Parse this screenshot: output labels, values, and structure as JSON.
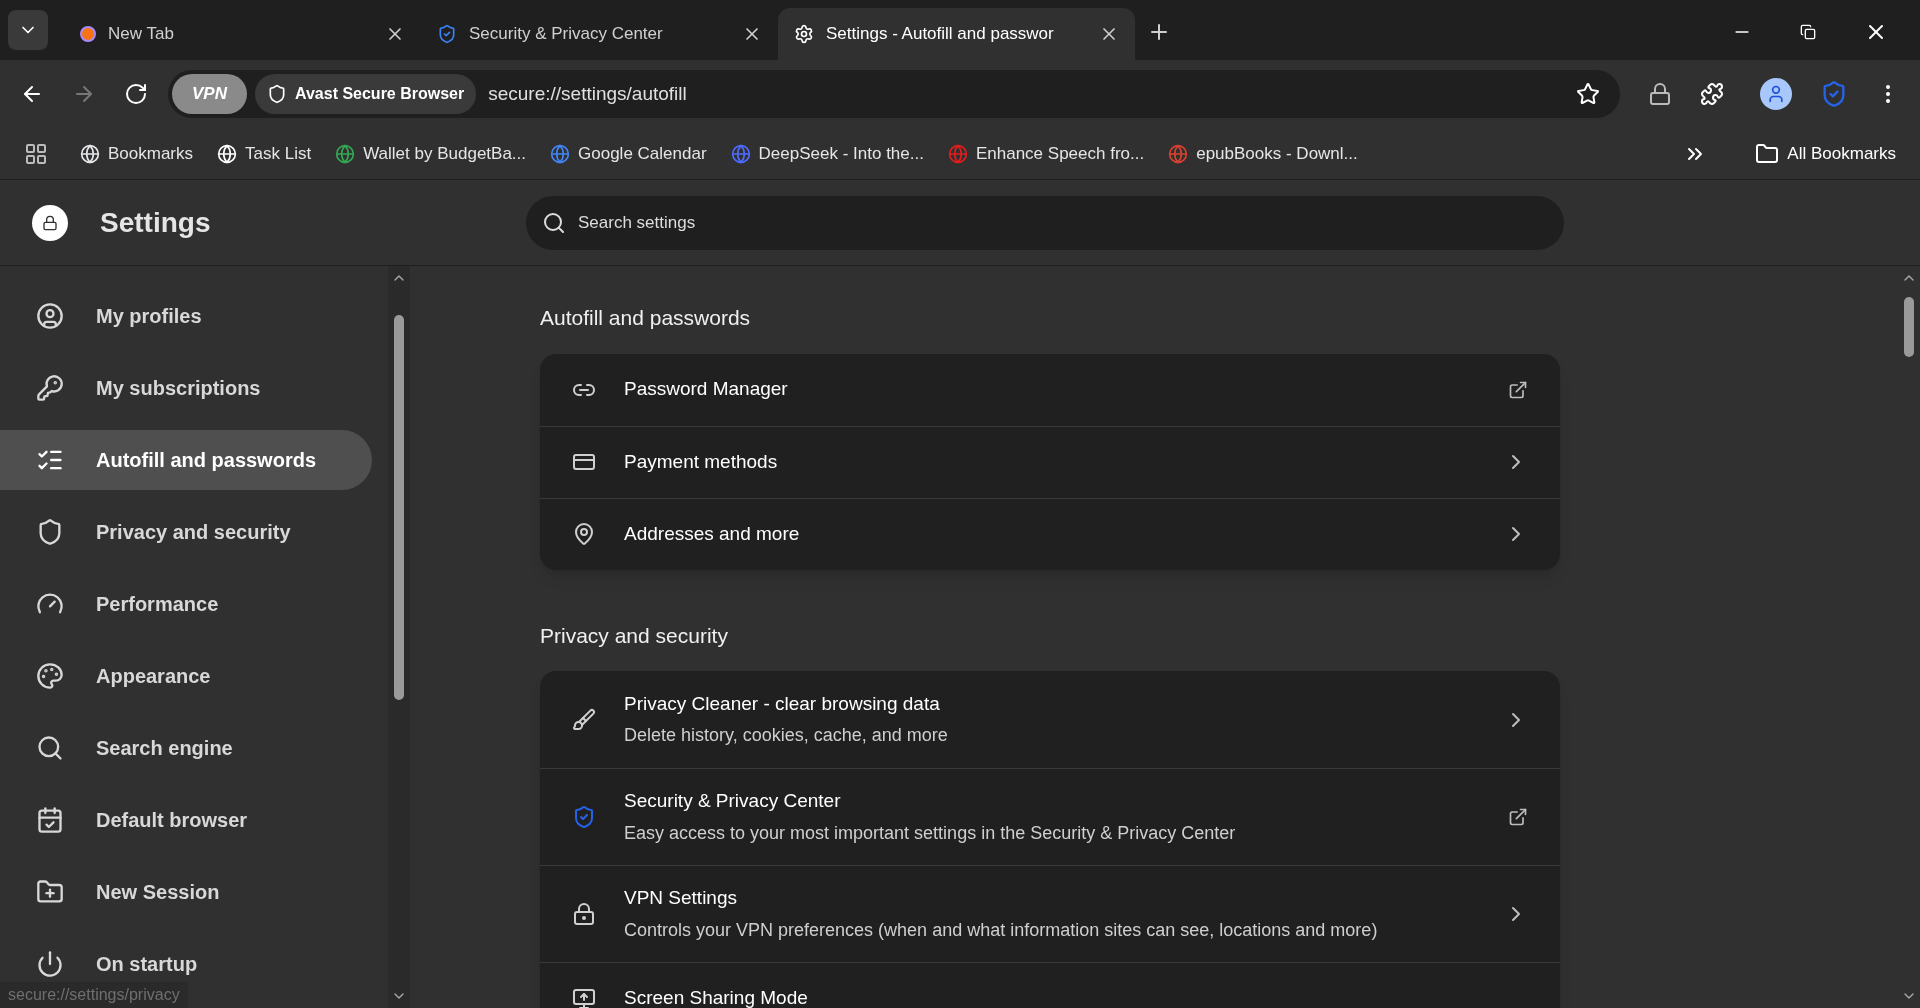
{
  "tabs": [
    {
      "title": "New Tab",
      "selected": false
    },
    {
      "title": "Security & Privacy Center",
      "selected": false
    },
    {
      "title": "Settings - Autofill and passwor",
      "selected": true
    }
  ],
  "toolbar": {
    "vpn_label": "VPN",
    "browser_label": "Avast Secure Browser",
    "url": "secure://settings/autofill"
  },
  "bookmarks": [
    {
      "title": "Bookmarks"
    },
    {
      "title": "Task List"
    },
    {
      "title": "Wallet by BudgetBa..."
    },
    {
      "title": "Google Calendar"
    },
    {
      "title": "DeepSeek - Into the..."
    },
    {
      "title": "Enhance Speech fro..."
    },
    {
      "title": "epubBooks - Downl..."
    }
  ],
  "all_bookmarks": "All Bookmarks",
  "header": {
    "title": "Settings",
    "search_placeholder": "Search settings"
  },
  "sidebar": {
    "items": [
      {
        "label": "My profiles",
        "selected": false
      },
      {
        "label": "My subscriptions",
        "selected": false
      },
      {
        "label": "Autofill and passwords",
        "selected": true
      },
      {
        "label": "Privacy and security",
        "selected": false
      },
      {
        "label": "Performance",
        "selected": false
      },
      {
        "label": "Appearance",
        "selected": false
      },
      {
        "label": "Search engine",
        "selected": false
      },
      {
        "label": "Default browser",
        "selected": false
      },
      {
        "label": "New Session",
        "selected": false
      },
      {
        "label": "On startup",
        "selected": false
      }
    ]
  },
  "sections": [
    {
      "title": "Autofill and passwords",
      "rows": [
        {
          "title": "Password Manager",
          "kind": "external"
        },
        {
          "title": "Payment methods",
          "kind": "subpage"
        },
        {
          "title": "Addresses and more",
          "kind": "subpage"
        }
      ]
    },
    {
      "title": "Privacy and security",
      "rows": [
        {
          "title": "Privacy Cleaner - clear browsing data",
          "subtitle": "Delete history, cookies, cache, and more",
          "kind": "subpage"
        },
        {
          "title": "Security & Privacy Center",
          "subtitle": "Easy access to your most important settings in the Security & Privacy Center",
          "kind": "external"
        },
        {
          "title": "VPN Settings",
          "subtitle": "Controls your VPN preferences (when and what information sites can see, locations and more)",
          "kind": "subpage"
        },
        {
          "title": "Screen Sharing Mode",
          "kind": "partial"
        }
      ]
    }
  ],
  "status_url": "secure://settings/privacy"
}
